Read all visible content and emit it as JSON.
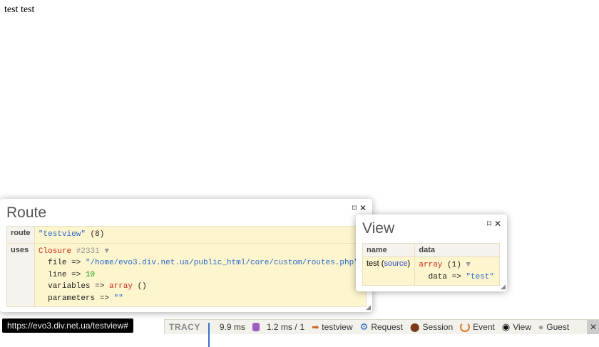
{
  "page": {
    "text": "test test"
  },
  "route_panel": {
    "title": "Route",
    "pin_icon": "⌑",
    "close_icon": "✕",
    "rows": {
      "route": {
        "key": "route",
        "value": "\"testview\"",
        "count": "(8)"
      },
      "uses": {
        "key": "uses",
        "closure_label": "Closure",
        "closure_id": "#2331",
        "file_key": "file => ",
        "file_value": "\"/home/evo3.div.net.ua/public_html/core/custom/routes.php\"",
        "line_key": "line => ",
        "line_value": "10",
        "variables_key": "variables => ",
        "variables_type": "array",
        "variables_value": " ()",
        "parameters_key": "parameters => ",
        "parameters_value": "\"\""
      }
    }
  },
  "view_panel": {
    "title": "View",
    "pin_icon": "⌑",
    "close_icon": "✕",
    "columns": [
      "name",
      "data"
    ],
    "row": {
      "name": "test",
      "source_link": "source",
      "data_type": "array",
      "data_count": " (1)",
      "data_key": "data => ",
      "data_value": "\"test\""
    }
  },
  "status_bar": {
    "url": "https://evo3.div.net.ua/testview#"
  },
  "tracy_bar": {
    "logo": "TRACY",
    "time": "9.9 ms",
    "db": "1.2 ms / ",
    "db_count": "1",
    "route": "testview",
    "request": "Request",
    "session": "Session",
    "event": "Event",
    "view": "View",
    "user": "Guest",
    "close": "✕"
  },
  "colors": {
    "dump_bg": "#fdf5ce",
    "string": "#2a6bc9",
    "keyword": "#d02d1e",
    "number": "#1a9a1a"
  }
}
